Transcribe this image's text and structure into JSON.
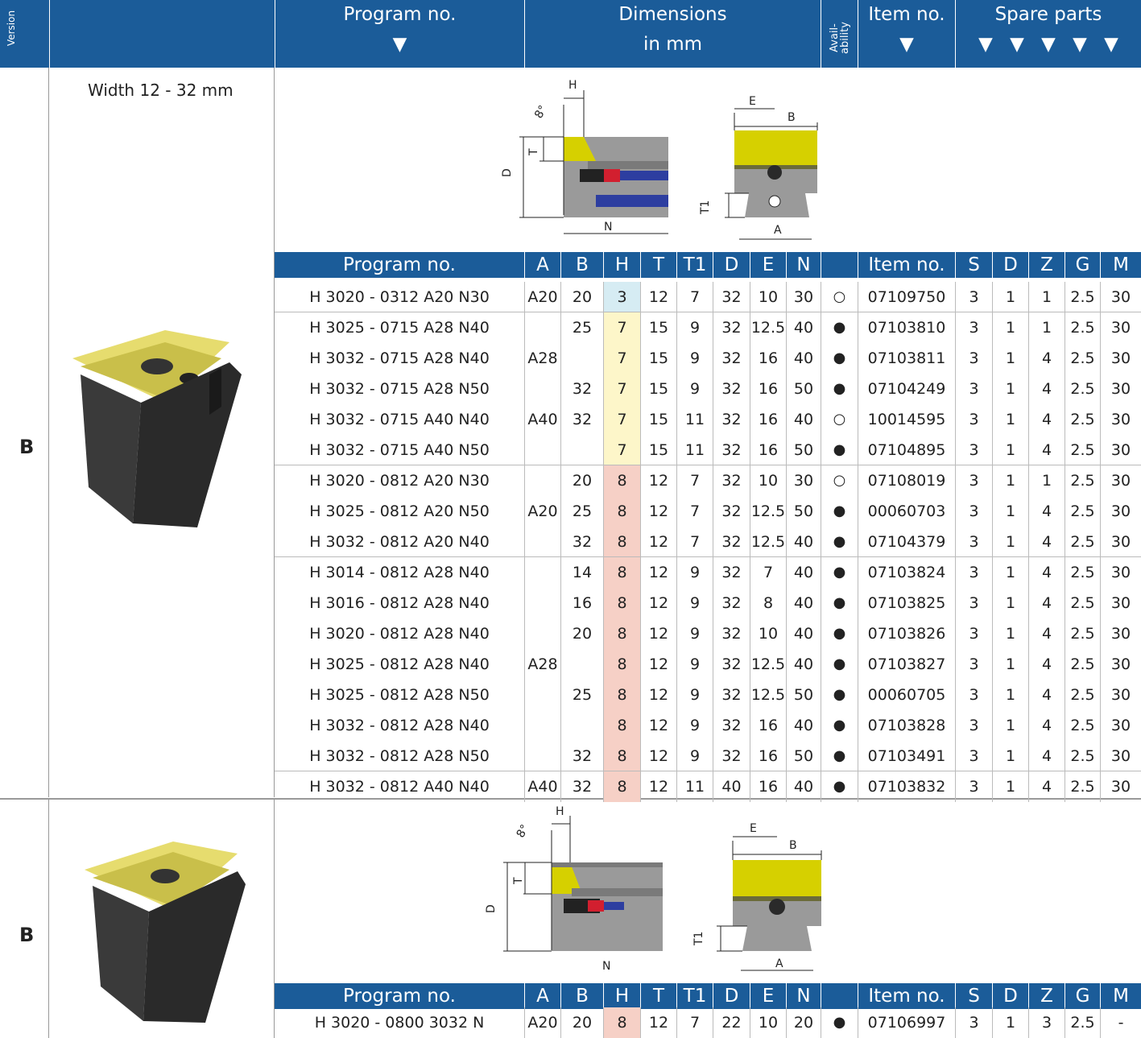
{
  "header": {
    "version": "Version",
    "program": "Program no.",
    "dimensions_1": "Dimensions",
    "dimensions_2": "in mm",
    "availability": "Avail-ability",
    "item": "Item no.",
    "spare": "Spare parts",
    "arrow": "▼"
  },
  "section1": {
    "width_label": "Width 12 - 32 mm",
    "version": "B"
  },
  "section2": {
    "version": "B"
  },
  "table_headers": [
    "Program no.",
    "A",
    "B",
    "H",
    "T",
    "T1",
    "D",
    "E",
    "N",
    "",
    "Item no.",
    "S",
    "D",
    "Z",
    "G",
    "M"
  ],
  "rows1": [
    {
      "prog": "H 3020 - 0312 A20 N30",
      "a": "A20",
      "b": "20",
      "h": "3",
      "t": "12",
      "t1": "7",
      "d": "32",
      "e": "10",
      "n": "30",
      "av": "○",
      "item": "07109750",
      "s": "3",
      "sd": "1",
      "z": "1",
      "g": "2.5",
      "m": "30"
    },
    {
      "prog": "H 3025 - 0715 A28 N40",
      "a": "",
      "b": "25",
      "h": "7",
      "t": "15",
      "t1": "9",
      "d": "32",
      "e": "12.5",
      "n": "40",
      "av": "●",
      "item": "07103810",
      "s": "3",
      "sd": "1",
      "z": "1",
      "g": "2.5",
      "m": "30"
    },
    {
      "prog": "H 3032 - 0715 A28 N40",
      "a": "A28",
      "b": "",
      "h": "7",
      "t": "15",
      "t1": "9",
      "d": "32",
      "e": "16",
      "n": "40",
      "av": "●",
      "item": "07103811",
      "s": "3",
      "sd": "1",
      "z": "4",
      "g": "2.5",
      "m": "30"
    },
    {
      "prog": "H 3032 - 0715 A28 N50",
      "a": "",
      "b": "32",
      "h": "7",
      "t": "15",
      "t1": "9",
      "d": "32",
      "e": "16",
      "n": "50",
      "av": "●",
      "item": "07104249",
      "s": "3",
      "sd": "1",
      "z": "4",
      "g": "2.5",
      "m": "30"
    },
    {
      "prog": "H 3032 - 0715 A40 N40",
      "a": "A40",
      "b": "32",
      "h": "7",
      "t": "15",
      "t1": "11",
      "d": "32",
      "e": "16",
      "n": "40",
      "av": "○",
      "item": "10014595",
      "s": "3",
      "sd": "1",
      "z": "4",
      "g": "2.5",
      "m": "30"
    },
    {
      "prog": "H 3032 - 0715 A40 N50",
      "a": "",
      "b": "",
      "h": "7",
      "t": "15",
      "t1": "11",
      "d": "32",
      "e": "16",
      "n": "50",
      "av": "●",
      "item": "07104895",
      "s": "3",
      "sd": "1",
      "z": "4",
      "g": "2.5",
      "m": "30"
    },
    {
      "prog": "H 3020 - 0812 A20 N30",
      "a": "",
      "b": "20",
      "h": "8",
      "t": "12",
      "t1": "7",
      "d": "32",
      "e": "10",
      "n": "30",
      "av": "○",
      "item": "07108019",
      "s": "3",
      "sd": "1",
      "z": "1",
      "g": "2.5",
      "m": "30"
    },
    {
      "prog": "H 3025 - 0812 A20 N50",
      "a": "A20",
      "b": "25",
      "h": "8",
      "t": "12",
      "t1": "7",
      "d": "32",
      "e": "12.5",
      "n": "50",
      "av": "●",
      "item": "00060703",
      "s": "3",
      "sd": "1",
      "z": "4",
      "g": "2.5",
      "m": "30"
    },
    {
      "prog": "H 3032 - 0812 A20 N40",
      "a": "",
      "b": "32",
      "h": "8",
      "t": "12",
      "t1": "7",
      "d": "32",
      "e": "12.5",
      "n": "40",
      "av": "●",
      "item": "07104379",
      "s": "3",
      "sd": "1",
      "z": "4",
      "g": "2.5",
      "m": "30"
    },
    {
      "prog": "H 3014 - 0812 A28 N40",
      "a": "",
      "b": "14",
      "h": "8",
      "t": "12",
      "t1": "9",
      "d": "32",
      "e": "7",
      "n": "40",
      "av": "●",
      "item": "07103824",
      "s": "3",
      "sd": "1",
      "z": "4",
      "g": "2.5",
      "m": "30"
    },
    {
      "prog": "H 3016 - 0812 A28 N40",
      "a": "",
      "b": "16",
      "h": "8",
      "t": "12",
      "t1": "9",
      "d": "32",
      "e": "8",
      "n": "40",
      "av": "●",
      "item": "07103825",
      "s": "3",
      "sd": "1",
      "z": "4",
      "g": "2.5",
      "m": "30"
    },
    {
      "prog": "H 3020 - 0812 A28 N40",
      "a": "",
      "b": "20",
      "h": "8",
      "t": "12",
      "t1": "9",
      "d": "32",
      "e": "10",
      "n": "40",
      "av": "●",
      "item": "07103826",
      "s": "3",
      "sd": "1",
      "z": "4",
      "g": "2.5",
      "m": "30"
    },
    {
      "prog": "H 3025 - 0812 A28 N40",
      "a": "A28",
      "b": "",
      "h": "8",
      "t": "12",
      "t1": "9",
      "d": "32",
      "e": "12.5",
      "n": "40",
      "av": "●",
      "item": "07103827",
      "s": "3",
      "sd": "1",
      "z": "4",
      "g": "2.5",
      "m": "30"
    },
    {
      "prog": "H 3025 - 0812 A28 N50",
      "a": "",
      "b": "25",
      "h": "8",
      "t": "12",
      "t1": "9",
      "d": "32",
      "e": "12.5",
      "n": "50",
      "av": "●",
      "item": "00060705",
      "s": "3",
      "sd": "1",
      "z": "4",
      "g": "2.5",
      "m": "30"
    },
    {
      "prog": "H 3032 - 0812 A28 N40",
      "a": "",
      "b": "",
      "h": "8",
      "t": "12",
      "t1": "9",
      "d": "32",
      "e": "16",
      "n": "40",
      "av": "●",
      "item": "07103828",
      "s": "3",
      "sd": "1",
      "z": "4",
      "g": "2.5",
      "m": "30"
    },
    {
      "prog": "H 3032 - 0812 A28 N50",
      "a": "",
      "b": "32",
      "h": "8",
      "t": "12",
      "t1": "9",
      "d": "32",
      "e": "16",
      "n": "50",
      "av": "●",
      "item": "07103491",
      "s": "3",
      "sd": "1",
      "z": "4",
      "g": "2.5",
      "m": "30"
    },
    {
      "prog": "H 3032 - 0812 A40 N40",
      "a": "A40",
      "b": "32",
      "h": "8",
      "t": "12",
      "t1": "11",
      "d": "40",
      "e": "16",
      "n": "40",
      "av": "●",
      "item": "07103832",
      "s": "3",
      "sd": "1",
      "z": "4",
      "g": "2.5",
      "m": "30"
    }
  ],
  "rows2": [
    {
      "prog": "H 3020 - 0800 3032 N",
      "a": "A20",
      "b": "20",
      "h": "8",
      "t": "12",
      "t1": "7",
      "d": "22",
      "e": "10",
      "n": "20",
      "av": "●",
      "item": "07106997",
      "s": "3",
      "sd": "1",
      "z": "3",
      "g": "2.5",
      "m": "-"
    }
  ],
  "drawing_labels": {
    "h": "H",
    "t": "T",
    "d": "D",
    "n": "N",
    "e": "E",
    "b": "B",
    "t1": "T1",
    "a": "A",
    "angle": "8°"
  },
  "colors": {
    "header_blue": "#1b5c99",
    "h_blue": "#d6ecf3",
    "h_yellow": "#fdf6c9",
    "h_red": "#f6d0c6",
    "insert_yellow": "#d6d000"
  }
}
